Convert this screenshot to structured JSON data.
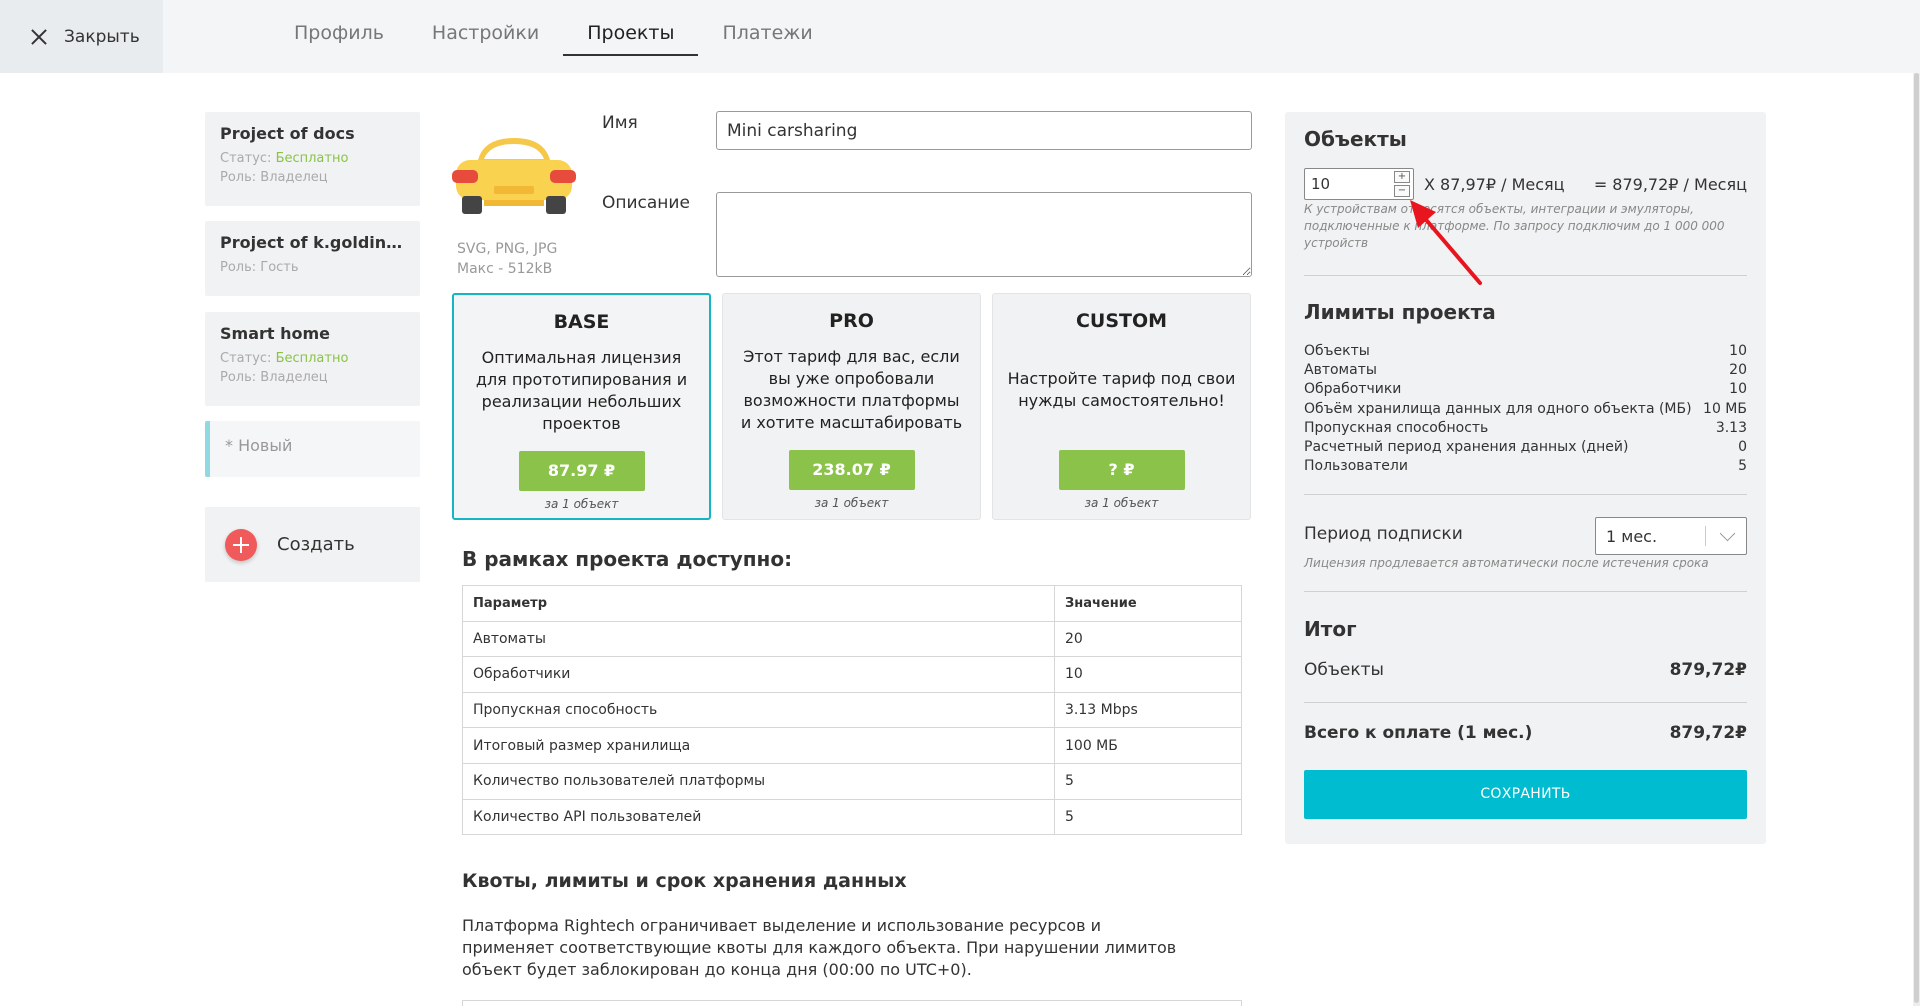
{
  "header": {
    "close_label": "Закрыть",
    "tabs": [
      {
        "label": "Профиль"
      },
      {
        "label": "Настройки"
      },
      {
        "label": "Проекты"
      },
      {
        "label": "Платежи"
      }
    ]
  },
  "projects": [
    {
      "name": "Project of docs",
      "status_label": "Статус:",
      "status_value": "Бесплатно",
      "role": "Роль: Владелец"
    },
    {
      "name": "Project of k.goldinova...",
      "role": "Роль: Гость"
    },
    {
      "name": "Smart home",
      "status_label": "Статус:",
      "status_value": "Бесплатно",
      "role": "Роль: Владелец"
    },
    {
      "name": "* Новый"
    }
  ],
  "create_label": "Создать",
  "image_hint": {
    "formats": "SVG, PNG, JPG",
    "max": "Макс - 512kB"
  },
  "form": {
    "name_label": "Имя",
    "name_value": "Mini carsharing",
    "description_label": "Описание",
    "description_value": ""
  },
  "plans": [
    {
      "title": "BASE",
      "desc": "Оптимальная лицензия для прототипирования и реализации небольших проектов",
      "price": "87.97 ₽",
      "per": "за 1 объект"
    },
    {
      "title": "PRO",
      "desc": "Этот тариф для вас, если вы уже опробовали возможности платформы и хотите масштабировать",
      "price": "238.07 ₽",
      "per": "за 1 объект"
    },
    {
      "title": "CUSTOM",
      "desc": "Настройте тариф под свои нужды самостоятельно!",
      "price": "? ₽",
      "per": "за 1 объект"
    }
  ],
  "available": {
    "title": "В рамках проекта доступно:",
    "headers": [
      "Параметр",
      "Значение"
    ],
    "rows": [
      [
        "Автоматы",
        "20"
      ],
      [
        "Обработчики",
        "10"
      ],
      [
        "Пропускная способность",
        "3.13 Mbps"
      ],
      [
        "Итоговый размер хранилища",
        "100 МБ"
      ],
      [
        "Количество пользователей платформы",
        "5"
      ],
      [
        "Количество API пользователей",
        "5"
      ]
    ]
  },
  "quotas": {
    "title": "Квоты, лимиты и срок хранения данных",
    "text": "Платформа Rightech ограничивает выделение и использование ресурсов и применяет соответствующие квоты для каждого объекта. При нарушении лимитов объект будет заблокирован до конца дня (00:00 по UTC+0)."
  },
  "panel": {
    "objects_title": "Объекты",
    "objects_count": "10",
    "unit_price": "X 87,97₽ / Месяц",
    "total_price": "= 879,72₽ / Месяц",
    "objects_hint": "К устройствам относятся объекты, интеграции и эмуляторы, подключенные к платформе. По запросу подключим до 1 000 000 устройств",
    "limits_title": "Лимиты проекта",
    "limits": [
      [
        "Объекты",
        "10"
      ],
      [
        "Автоматы",
        "20"
      ],
      [
        "Обработчики",
        "10"
      ],
      [
        "Объём хранилища данных для одного объекта (МБ)",
        "10 МБ"
      ],
      [
        "Пропускная способность",
        "3.13"
      ],
      [
        "Расчетный период хранения данных (дней)",
        "0"
      ],
      [
        "Пользователи",
        "5"
      ]
    ],
    "period_label": "Период подписки",
    "period_value": "1 мес.",
    "period_hint": "Лицензия продлевается автоматически после истечения срока",
    "total_title": "Итог",
    "total_objects_label": "Объекты",
    "total_objects_value": "879,72₽",
    "grand_label": "Всего к оплате (1 мес.)",
    "grand_value": "879,72₽",
    "save_label": "СОХРАНИТЬ"
  },
  "colors": {
    "accent": "#00bcd0",
    "price": "#8bc34a",
    "annotation_arrow": "#e8141e"
  }
}
